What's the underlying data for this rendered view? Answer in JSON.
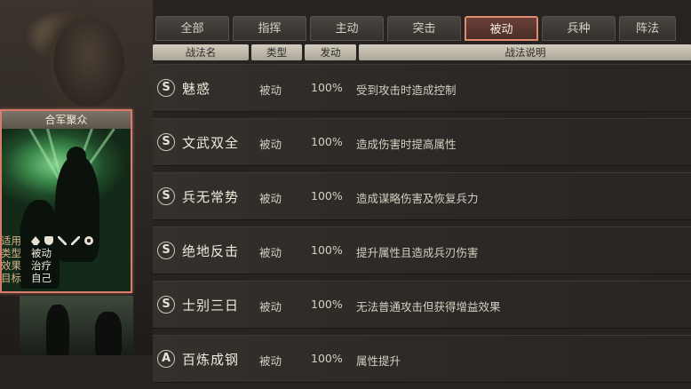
{
  "tabs": [
    "全部",
    "指挥",
    "主动",
    "突击",
    "被动",
    "兵种",
    "阵法"
  ],
  "active_tab": "被动",
  "table_headers": [
    "战法名",
    "类型",
    "发动",
    "战法说明"
  ],
  "skills": [
    {
      "grade": "S",
      "name": "魅惑",
      "type": "被动",
      "rate": "100%",
      "desc": "受到攻击时造成控制"
    },
    {
      "grade": "S",
      "name": "文武双全",
      "type": "被动",
      "rate": "100%",
      "desc": "造成伤害时提高属性"
    },
    {
      "grade": "S",
      "name": "兵无常势",
      "type": "被动",
      "rate": "100%",
      "desc": "造成谋略伤害及恢复兵力"
    },
    {
      "grade": "S",
      "name": "绝地反击",
      "type": "被动",
      "rate": "100%",
      "desc": "提升属性且造成兵刃伤害"
    },
    {
      "grade": "S",
      "name": "士别三日",
      "type": "被动",
      "rate": "100%",
      "desc": "无法普通攻击但获得增益效果"
    },
    {
      "grade": "A",
      "name": "百炼成钢",
      "type": "被动",
      "rate": "100%",
      "desc": "属性提升"
    }
  ],
  "card": {
    "title": "合军聚众",
    "suit_label": "适用",
    "suit_icons": [
      "cavalry-icon",
      "shield-icon",
      "bow-icon",
      "spear-icon",
      "wheel-icon"
    ],
    "type_label": "类型",
    "type_value": "被动",
    "effect_label": "效果",
    "effect_value": "治疗",
    "target_label": "目标",
    "target_value": "自己"
  },
  "colors": {
    "accent": "#e08a72",
    "background": "#262321",
    "header_bar": "#c4beb2"
  }
}
